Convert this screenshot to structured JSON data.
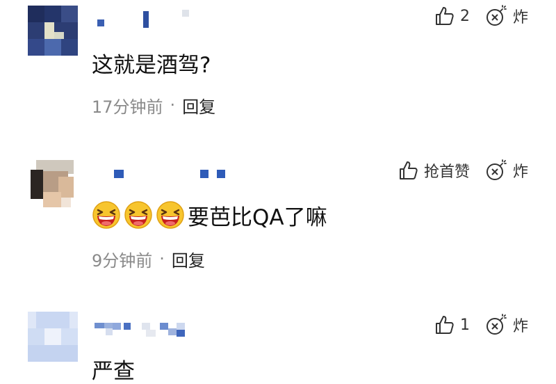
{
  "comments": [
    {
      "like_label": "2",
      "bomb_label": "炸",
      "text": "这就是酒驾?",
      "time": "17分钟前",
      "separator": "·",
      "reply": "回复"
    },
    {
      "like_label": "抢首赞",
      "bomb_label": "炸",
      "emoji_name": "grinning-squint-emoji",
      "emoji_count": 3,
      "text": "要芭比QA了嘛",
      "time": "9分钟前",
      "separator": "·",
      "reply": "回复"
    },
    {
      "like_label": "1",
      "bomb_label": "炸",
      "text": "严查"
    }
  ],
  "icons": {
    "like": "thumbs-up-icon",
    "bomb": "bomb-icon"
  },
  "colors": {
    "text": "#111111",
    "meta": "#8a8a8a",
    "name_pixel": "#2e5bb8"
  }
}
